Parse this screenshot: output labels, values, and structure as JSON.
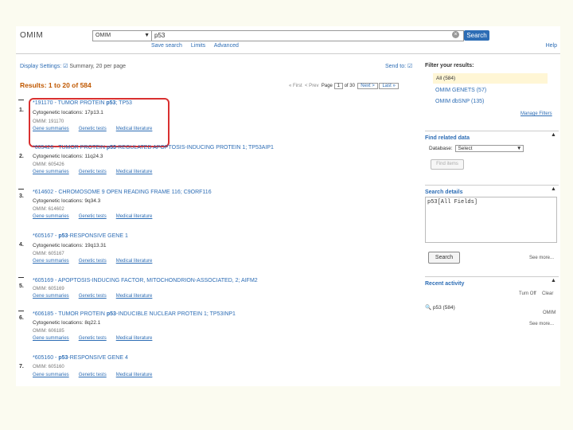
{
  "header": {
    "logo": "OMIM",
    "db_select": "OMIM",
    "search_value": "p53",
    "search_button": "Search",
    "help": "Help",
    "links": [
      "Save search",
      "Limits",
      "Advanced"
    ]
  },
  "display": {
    "label": "Display Settings:",
    "value": "Summary, 20 per page",
    "send_to": "Send to:",
    "results": "Results: 1 to 20 of 584"
  },
  "pager": {
    "first": "« First",
    "prev": "< Prev",
    "page_label": "Page",
    "page_value": "1",
    "of": "of 30",
    "next": "Next >",
    "last": "Last »"
  },
  "results": [
    {
      "num": "1.",
      "id_text": "*191170",
      "title_pre": " - TUMOR PROTEIN ",
      "title_bold": "p53",
      "title_post": "; TP53",
      "cyto": "Cytogenetic locations: 17p13.1",
      "omim": "OMIM: 191170"
    },
    {
      "num": "2.",
      "id_text": "*605426",
      "title_pre": " - TUMOR PROTEIN ",
      "title_bold": "p53",
      "title_post": "-REGULATED APOPTOSIS-INDUCING PROTEIN 1; TP53AIP1",
      "cyto": "Cytogenetic locations: 11q24.3",
      "omim": "OMIM: 605426"
    },
    {
      "num": "3.",
      "id_text": "*614602",
      "title_pre": " - CHROMOSOME 9 OPEN READING FRAME 116; C9ORF116",
      "title_bold": "",
      "title_post": "",
      "cyto": "Cytogenetic locations: 9q34.3",
      "omim": "OMIM: 614602"
    },
    {
      "num": "4.",
      "id_text": "*605167",
      "title_pre": " - ",
      "title_bold": "p53",
      "title_post": "-RESPONSIVE GENE 1",
      "cyto": "Cytogenetic locations: 19q13.31",
      "omim": "OMIM: 605167"
    },
    {
      "num": "5.",
      "id_text": "*605169",
      "title_pre": " - APOPTOSIS-INDUCING FACTOR, MITOCHONDRION-ASSOCIATED, 2; AIFM2",
      "title_bold": "",
      "title_post": "",
      "cyto": "",
      "omim": "OMIM: 605169"
    },
    {
      "num": "6.",
      "id_text": "*606185",
      "title_pre": " - TUMOR PROTEIN ",
      "title_bold": "p53",
      "title_post": "-INDUCIBLE NUCLEAR PROTEIN 1; TP53INP1",
      "cyto": "Cytogenetic locations: 8q22.1",
      "omim": "OMIM: 606185"
    },
    {
      "num": "7.",
      "id_text": "*605160",
      "title_pre": " - ",
      "title_bold": "p53",
      "title_post": "-RESPONSIVE GENE 4",
      "cyto": "",
      "omim": "OMIM: 605160"
    }
  ],
  "result_links": [
    "Gene summaries",
    "Genetic tests",
    "Medical literature"
  ],
  "sidebar": {
    "filter_title": "Filter your results:",
    "filter_all": "All (584)",
    "filter_links": [
      "OMIM GENETS (57)",
      "OMIM dbSNP (135)"
    ],
    "manage": "Manage Filters",
    "find_related": "Find related data",
    "database_label": "Database:",
    "database_value": "Select",
    "find_items": "Find items",
    "search_details": "Search details",
    "query": "p53[All Fields]",
    "search_btn": "Search",
    "see_more": "See more...",
    "recent_activity": "Recent activity",
    "turn_off": "Turn Off",
    "clear": "Clear",
    "recent_item": "p53 (584)",
    "omim": "OMIM",
    "see_more2": "See more..."
  }
}
